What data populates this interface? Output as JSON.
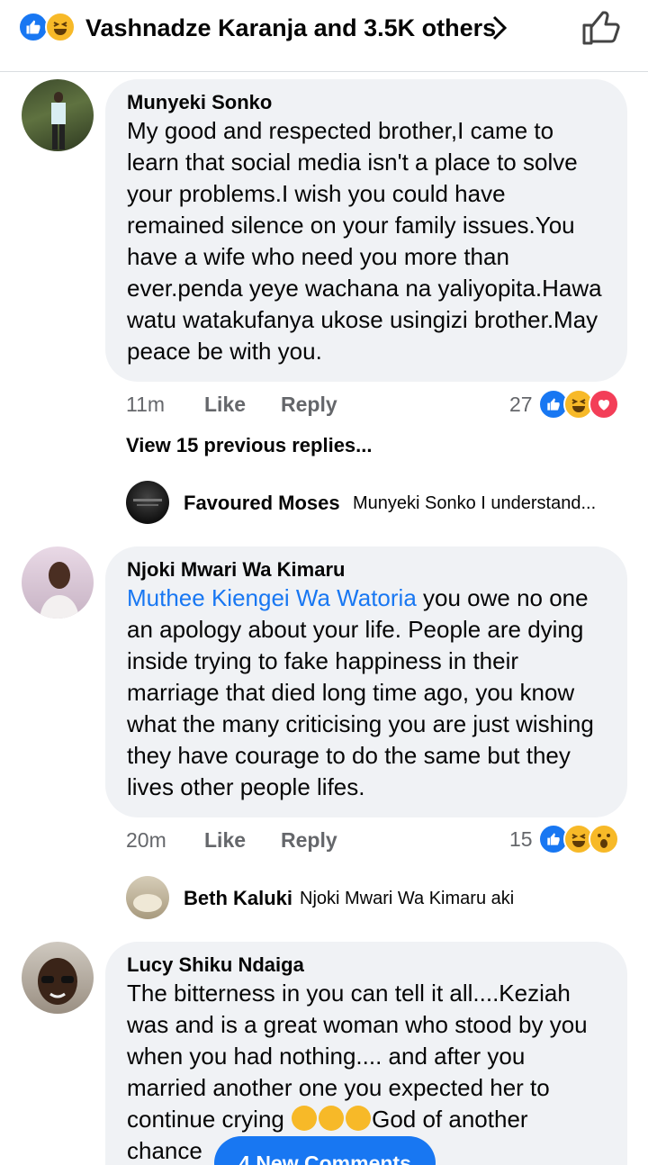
{
  "header": {
    "reaction_summary": "Vashnadze Karanja and 3.5K others",
    "reaction_icons": [
      "like-icon",
      "haha-icon"
    ]
  },
  "comments": [
    {
      "author": "Munyeki Sonko",
      "text": "My good and respected brother,I came to learn that social media isn't a place to solve your problems.I wish you could have remained silence on your family issues.You have a wife who need you more than ever.penda yeye wachana na yaliyopita.Hawa watu watakufanya ukose usingizi brother.May peace be with you.",
      "time": "11m",
      "like_label": "Like",
      "reply_label": "Reply",
      "reaction_count": "27",
      "reactions": [
        "like-icon",
        "haha-icon",
        "love-icon"
      ]
    },
    {
      "author": "Njoki Mwari Wa Kimaru",
      "mention": "Muthee Kiengei Wa Watoria",
      "text": " you owe no one an apology about your life.  People are dying inside trying to fake happiness in their marriage that died long time ago, you know what the many criticising you are just wishing they have courage to do the same but they lives other people lifes.",
      "time": "20m",
      "like_label": "Like",
      "reply_label": "Reply",
      "reaction_count": "15",
      "reactions": [
        "like-icon",
        "haha-icon",
        "wow-icon"
      ]
    },
    {
      "author": "Lucy Shiku Ndaiga",
      "text_part1": "The bitterness in you can tell it all....Keziah was and is a great woman who stood by you when you had nothing.... and after you married another one you expected her to continue crying ",
      "text_part2": "God of another chance"
    }
  ],
  "view_previous_replies": "View 15 previous replies...",
  "replies": [
    {
      "name": "Favoured Moses",
      "text": "Munyeki Sonko I understand..."
    },
    {
      "name": "Beth Kaluki",
      "text": "Njoki Mwari Wa Kimaru aki"
    }
  ],
  "new_comments_button": "4 New Comments",
  "colors": {
    "accent": "#1877f2",
    "bubble": "#f0f2f5",
    "meta": "#65676b",
    "love": "#f33e58",
    "haha": "#f7b928"
  }
}
